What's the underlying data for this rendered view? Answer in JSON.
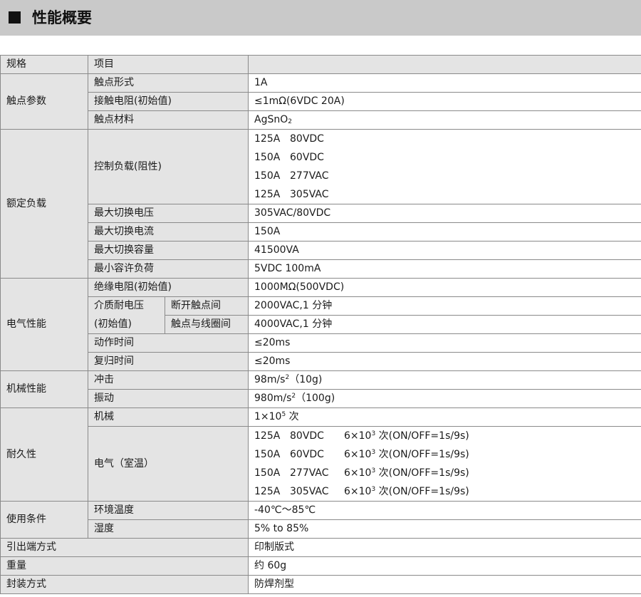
{
  "header": {
    "title": "性能概要"
  },
  "table": {
    "head": {
      "spec": "规格",
      "item": "项目"
    },
    "contact": {
      "group": "触点参数",
      "form_label": "触点形式",
      "form_value": "1A",
      "resistance_label": "接触电阻(初始值)",
      "resistance_value": "≤1mΩ(6VDC 20A)",
      "material_label": "触点材料",
      "material_value_main": "AgSnO",
      "material_value_sub": "2"
    },
    "rated": {
      "group": "额定负载",
      "control_label": "控制负载(阻性)",
      "control_values": [
        {
          "a": "125A",
          "b": "80VDC"
        },
        {
          "a": "150A",
          "b": "60VDC"
        },
        {
          "a": "150A",
          "b": "277VAC"
        },
        {
          "a": "125A",
          "b": "305VAC"
        }
      ],
      "max_voltage_label": "最大切换电压",
      "max_voltage_value": "305VAC/80VDC",
      "max_current_label": "最大切换电流",
      "max_current_value": "150A",
      "max_capacity_label": "最大切换容量",
      "max_capacity_value": "41500VA",
      "min_load_label": "最小容许负荷",
      "min_load_value": "5VDC 100mA"
    },
    "electrical": {
      "group": "电气性能",
      "insulation_label": "绝缘电阻(初始值)",
      "insulation_value": "1000MΩ(500VDC)",
      "dielectric_label_1": "介质耐电压",
      "dielectric_label_2": "(初始值)",
      "open_contacts_label": "断开触点间",
      "open_contacts_value": "2000VAC,1 分钟",
      "contact_coil_label": "触点与线圈间",
      "contact_coil_value": "4000VAC,1 分钟",
      "operate_label": "动作时间",
      "operate_value": "≤20ms",
      "release_label": "复归时间",
      "release_value": "≤20ms"
    },
    "mechanical": {
      "group": "机械性能",
      "shock_label": "冲击",
      "shock_value_a": "98m/s",
      "shock_value_sup": "2",
      "shock_value_b": "（10g)",
      "vibration_label": "振动",
      "vibration_value_a": "980m/s",
      "vibration_value_sup": "2",
      "vibration_value_b": "（100g)"
    },
    "durability": {
      "group": "耐久性",
      "mech_label": "机械",
      "mech_value_a": "1×10",
      "mech_value_sup": "5",
      "mech_value_b": " 次",
      "elec_label": "电气（室温）",
      "elec_values": [
        {
          "a": "125A",
          "b": "80VDC",
          "c": "6×10",
          "sup": "3",
          "d": " 次(ON/OFF=1s/9s)"
        },
        {
          "a": "150A",
          "b": "60VDC",
          "c": "6×10",
          "sup": "3",
          "d": " 次(ON/OFF=1s/9s)"
        },
        {
          "a": "150A",
          "b": "277VAC",
          "c": "6×10",
          "sup": "3",
          "d": " 次(ON/OFF=1s/9s)"
        },
        {
          "a": "125A",
          "b": "305VAC",
          "c": "6×10",
          "sup": "3",
          "d": " 次(ON/OFF=1s/9s)"
        }
      ]
    },
    "conditions": {
      "group": "使用条件",
      "temp_label": "环境温度",
      "temp_value": "-40℃～85℃",
      "humidity_label": "湿度",
      "humidity_value": "5% to 85%"
    },
    "terminal": {
      "label": "引出端方式",
      "value": "印制版式"
    },
    "weight": {
      "label": "重量",
      "value": "约 60g"
    },
    "sealing": {
      "label": "封装方式",
      "value": "防焊剂型"
    }
  }
}
